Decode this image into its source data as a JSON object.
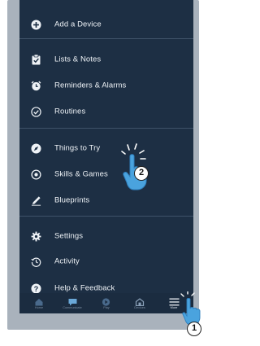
{
  "menu": {
    "items": [
      {
        "label": "Add a Device",
        "icon": "plus-circle-icon"
      },
      {
        "label": "Lists & Notes",
        "icon": "clipboard-icon"
      },
      {
        "label": "Reminders & Alarms",
        "icon": "alarm-icon"
      },
      {
        "label": "Routines",
        "icon": "check-circle-icon"
      },
      {
        "label": "Things to Try",
        "icon": "compass-icon"
      },
      {
        "label": "Skills & Games",
        "icon": "location-pin-icon"
      },
      {
        "label": "Blueprints",
        "icon": "pencil-icon"
      },
      {
        "label": "Settings",
        "icon": "gear-icon"
      },
      {
        "label": "Activity",
        "icon": "history-icon"
      },
      {
        "label": "Help & Feedback",
        "icon": "help-icon"
      }
    ]
  },
  "bottom_nav": {
    "tabs": [
      {
        "label": "Home",
        "icon": "home-icon"
      },
      {
        "label": "Communicate",
        "icon": "chat-bubble-icon"
      },
      {
        "label": "Play",
        "icon": "play-icon"
      },
      {
        "label": "Devices",
        "icon": "devices-icon"
      },
      {
        "label": "More",
        "icon": "hamburger-menu-icon"
      }
    ]
  },
  "callouts": {
    "step1": "1",
    "step2": "2"
  },
  "colors": {
    "screen_bg": "#1d2f44",
    "text": "#eef2f6",
    "frame": "#a9b2bc",
    "hand": "#4aa3de"
  }
}
